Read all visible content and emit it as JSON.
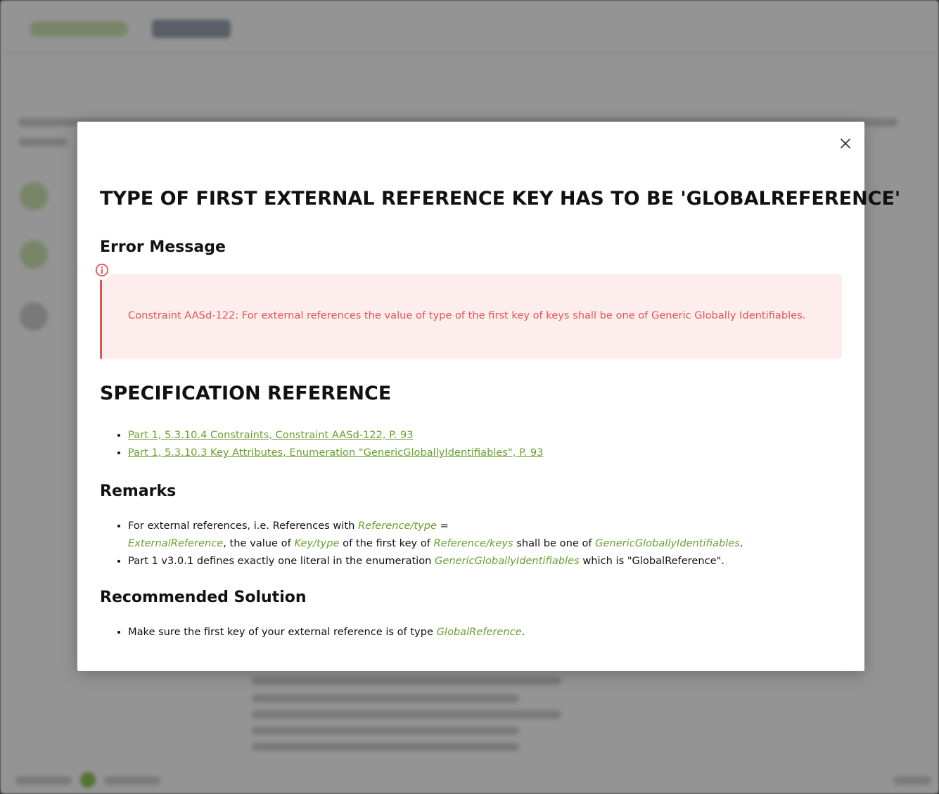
{
  "modal": {
    "title": "TYPE OF FIRST EXTERNAL REFERENCE KEY HAS TO BE 'GLOBALREFERENCE'",
    "close_icon": "close-icon",
    "error_section": {
      "heading": "Error Message",
      "icon": "info-circle-icon",
      "message": "Constraint AASd-122: For external references the value of type of the first key of keys shall be one of Generic Globally Identifiables."
    },
    "specification": {
      "heading": "SPECIFICATION REFERENCE",
      "links": [
        "Part 1, 5.3.10.4 Constraints, Constraint AASd-122, P. 93",
        "Part 1, 5.3.10.3 Key Attributes, Enumeration \"GenericGloballyIdentifiables\", P. 93"
      ]
    },
    "remarks": {
      "heading": "Remarks",
      "item1": {
        "t1": "For external references, i.e. References with ",
        "c1": "Reference/type",
        "t2": " = ",
        "c2": "ExternalReference",
        "t3": ", the value of ",
        "c3": "Key/type",
        "t4": " of the first key of ",
        "c4": "Reference/keys",
        "t5": " shall be one of ",
        "c5": "GenericGloballyIdentifiables",
        "t6": "."
      },
      "item2": {
        "t1": "Part 1 v3.0.1 defines exactly one literal in the enumeration ",
        "c1": "GenericGloballyIdentifiables",
        "t2": " which is \"GlobalReference\"."
      }
    },
    "solution": {
      "heading": "Recommended Solution",
      "item1": {
        "t1": "Make sure the first key of your external reference is of type ",
        "c1": "GlobalReference",
        "t2": "."
      }
    }
  },
  "colors": {
    "accent_green": "#6aa02f",
    "error_red": "#e05555",
    "error_bg": "#fdeeed",
    "overlay": "rgba(0,0,0,0.42)"
  }
}
